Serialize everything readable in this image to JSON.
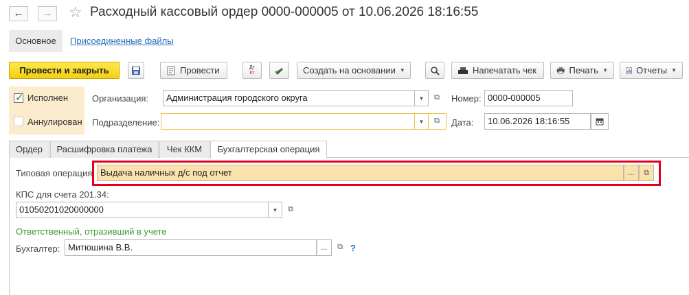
{
  "window": {
    "back_icon": "arrow-left-icon",
    "forward_icon": "arrow-right-icon",
    "star_icon": "star-icon",
    "title": "Расходный кассовый ордер 0000-000005 от 10.06.2026 18:16:55"
  },
  "sections": {
    "main": "Основное",
    "attached": "Присоединенные файлы"
  },
  "toolbar": {
    "post_close": "Провести и закрыть",
    "post": "Провести",
    "create_based": "Создать на основании",
    "print_receipt": "Напечатать чек",
    "print": "Печать",
    "reports": "Отчеты",
    "dtkt_top": "Дт",
    "dtkt_bottom": "Кт"
  },
  "flags": {
    "executed": "Исполнен",
    "cancelled": "Аннулирован",
    "executed_checked": true,
    "cancelled_checked": false
  },
  "header": {
    "org_label": "Организация:",
    "org_value": "Администрация городского округа",
    "dept_label": "Подразделение:",
    "dept_value": "",
    "number_label": "Номер:",
    "number_value": "0000-000005",
    "date_label": "Дата:",
    "date_value": "10.06.2026 18:16:55"
  },
  "tabs": [
    "Ордер",
    "Расшифровка платежа",
    "Чек ККМ",
    "Бухгалтерская операция"
  ],
  "active_tab": 3,
  "accounting": {
    "operation_label": "Типовая операция:",
    "operation_value": "Выдача наличных д/с под отчет",
    "kps_label": "КПС для счета 201.34:",
    "kps_value": "01050201020000000",
    "responsible_header": "Ответственный, отразивший в учете",
    "accountant_label": "Бухгалтер:",
    "accountant_value": "Митюшина В.В.",
    "help": "?"
  },
  "colors": {
    "primary_button": "#f2cf12",
    "highlight_border": "#e3001b",
    "operation_field": "#fbe2ab",
    "flags_area": "#fbeccd",
    "link": "#2a6ebb",
    "green_text": "#3a9b33"
  }
}
